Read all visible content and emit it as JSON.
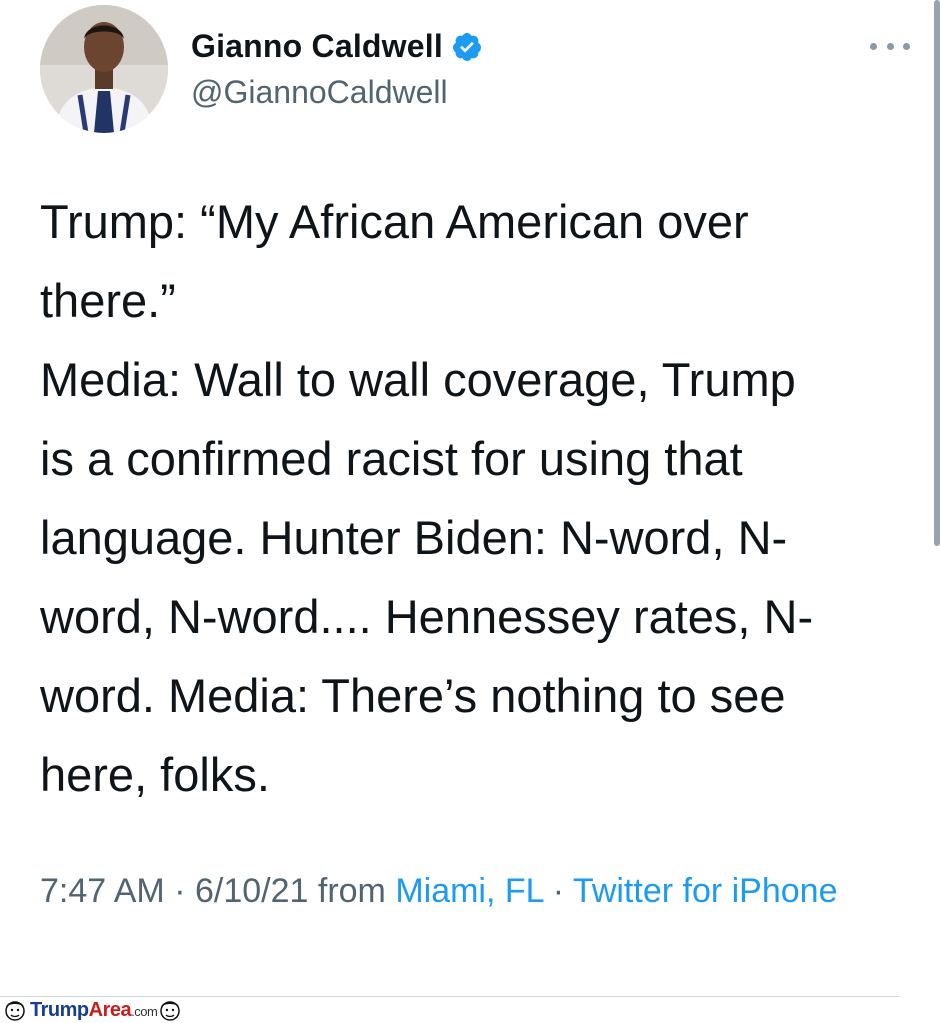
{
  "tweet": {
    "author": {
      "display_name": "Gianno Caldwell",
      "handle": "@GiannoCaldwell",
      "verified": true,
      "verified_color": "#1d9bf0"
    },
    "text": "Trump: “My African American over there.” Media: Wall to wall coverage, Trump is a confirmed racist for using that language. Hunter Biden: N-word, N-word, N-word.... Hennessey rates, N-word. Media: There’s nothing to see here, folks.",
    "text_lines": [
      "Trump: “My African American over",
      "there.”",
      "Media: Wall to wall coverage, Trump",
      "is a confirmed racist for using that",
      "language. Hunter Biden: N-word, N-",
      "word, N-word.... Hennessey rates, N-",
      "word. Media: There’s nothing to see",
      "here, folks."
    ],
    "meta": {
      "time": "7:47 AM",
      "sep1": " · ",
      "date": "6/10/21",
      "from_label": " from ",
      "location": "Miami, FL",
      "sep2": " · ",
      "source": "Twitter for iPhone"
    }
  },
  "icons": {
    "more": "more-horizontal-icon",
    "verified": "verified-badge-icon"
  },
  "watermark": {
    "part1": "Trump",
    "part2": "Area",
    "part3": ".com"
  },
  "colors": {
    "link": "#1d9bf0",
    "secondary_text": "#536471",
    "primary_text": "#0f1419"
  }
}
